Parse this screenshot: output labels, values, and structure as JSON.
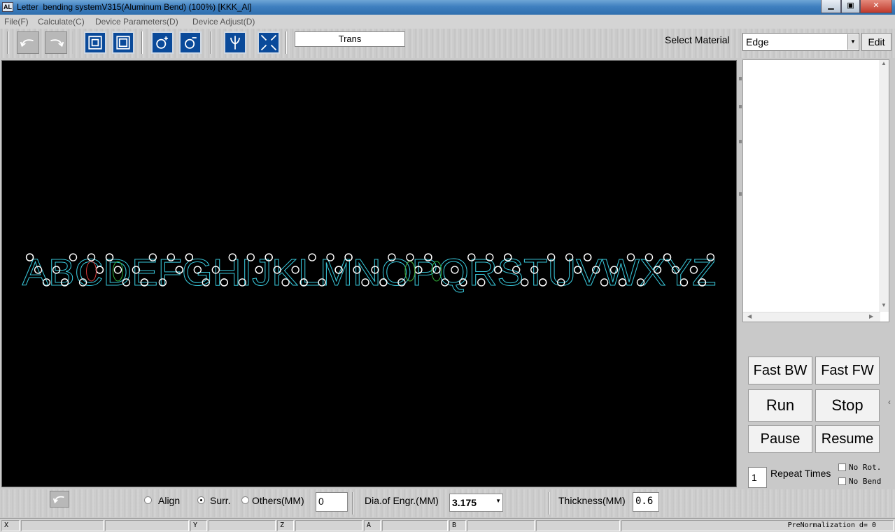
{
  "window": {
    "title": "Letter  bending systemV315(Aluminum Bend) (100%) [KKK_Al]",
    "icon_text": "AL",
    "min_glyph": "▁",
    "max_glyph": "▣",
    "close_glyph": "✕"
  },
  "menu": {
    "items": [
      "File(F)",
      "Calculate(C)",
      "Device Parameters(D)",
      "Device Adjust(D)"
    ]
  },
  "toolbar": {
    "buttons": [
      "undo-arrow-icon",
      "redo-arrow-icon",
      "outer-frame-icon",
      "inner-frame-icon",
      "add-circle-icon",
      "remove-circle-icon",
      "split-y-icon",
      "expand-corners-icon"
    ],
    "mode_field": "Trans",
    "select_material_label": "Select Material",
    "material_value": "Edge",
    "edit_label": "Edit"
  },
  "canvas": {
    "text": "ABCDEFGHIJKLMNOPQRSTUVWXYZ",
    "outline_colors": {
      "outline": "#38c6d9",
      "inner_green": "#2fae3a",
      "inner_red": "#d33a3a",
      "markers": "#ffffff"
    }
  },
  "controls": {
    "fast_bw": "Fast BW",
    "fast_fw": "Fast FW",
    "run": "Run",
    "stop": "Stop",
    "pause": "Pause",
    "resume": "Resume",
    "repeat_value": "1",
    "repeat_label": "Repeat Times",
    "no_rot": "No Rot.",
    "no_bend": "No Bend"
  },
  "options": {
    "align": "Align",
    "surr": "Surr.",
    "others": "Others(MM)",
    "others_value": "0",
    "dia_label": "Dia.of Engr.(MM)",
    "dia_value": "3.175",
    "thickness_label": "Thickness(MM)",
    "thickness_value": "0.6",
    "selected": "Surr."
  },
  "status": {
    "x": "X",
    "y": "Y",
    "z": "Z",
    "a": "A",
    "b": "B",
    "info": "PreNormalization d= 0"
  }
}
